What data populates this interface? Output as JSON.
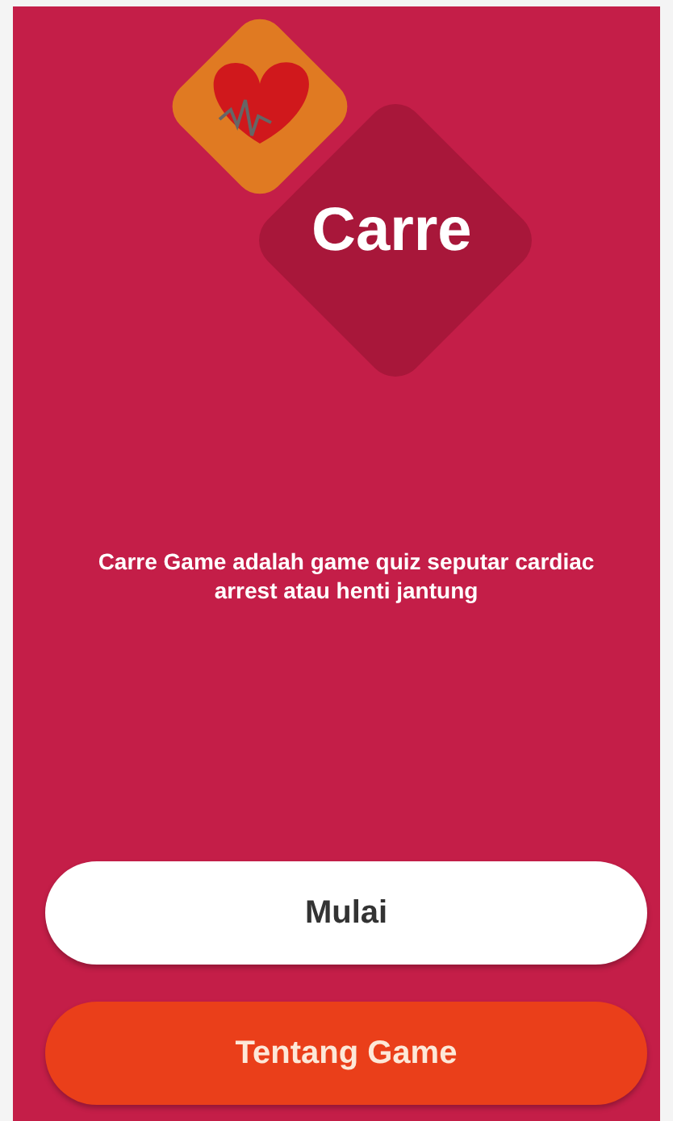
{
  "app": {
    "title": "Carre"
  },
  "description": "Carre Game adalah game quiz seputar cardiac arrest atau henti jantung",
  "buttons": [
    {
      "label": "Mulai",
      "kind": "primary"
    },
    {
      "label": "Tentang Game",
      "kind": "secondary"
    }
  ]
}
